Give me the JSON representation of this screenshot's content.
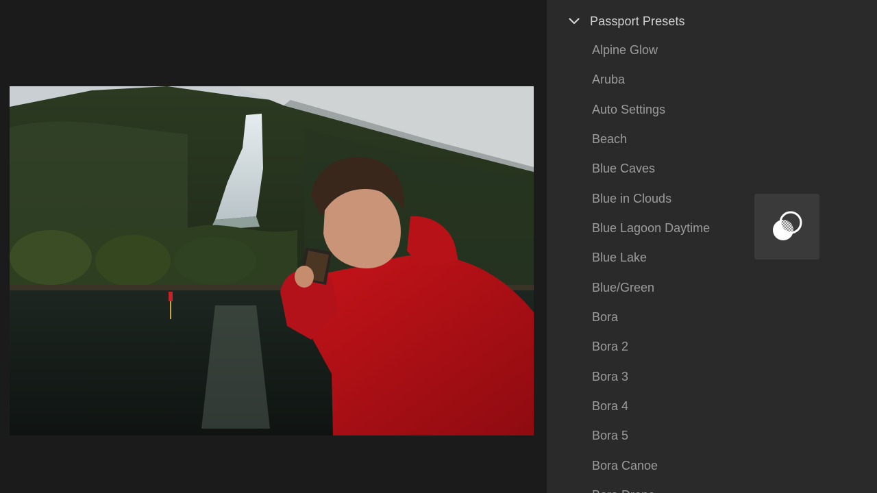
{
  "panel": {
    "group": {
      "title": "Passport Presets",
      "expanded": true,
      "icon": "chevron-down-icon"
    },
    "presets": [
      {
        "label": "Alpine Glow"
      },
      {
        "label": "Aruba"
      },
      {
        "label": "Auto Settings"
      },
      {
        "label": "Beach"
      },
      {
        "label": "Blue Caves"
      },
      {
        "label": "Blue in Clouds"
      },
      {
        "label": "Blue Lagoon Daytime"
      },
      {
        "label": "Blue Lake"
      },
      {
        "label": "Blue/Green"
      },
      {
        "label": "Bora"
      },
      {
        "label": "Bora 2"
      },
      {
        "label": "Bora 3"
      },
      {
        "label": "Bora 4"
      },
      {
        "label": "Bora 5"
      },
      {
        "label": "Bora Canoe"
      },
      {
        "label": "Bora Drone"
      }
    ],
    "compare_tile": {
      "icon": "preset-preview-icon"
    }
  },
  "colors": {
    "canvas_bg": "#1b1b1b",
    "panel_bg": "#2a2a2a",
    "header_text": "#d2d2d2",
    "item_text": "#9c9c9c",
    "tile_bg": "#3a3a3a"
  }
}
